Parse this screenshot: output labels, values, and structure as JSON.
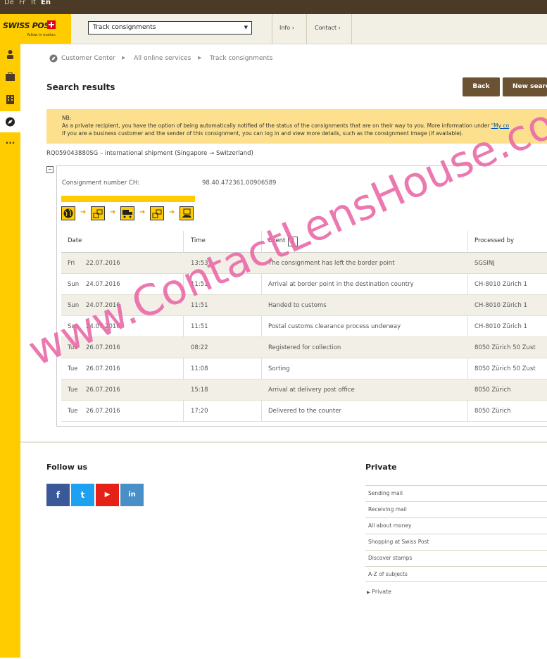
{
  "languages": [
    "De",
    "Fr",
    "It",
    "En"
  ],
  "active_language": "En",
  "logo": {
    "text": "SWISS POST",
    "tagline": "Yellow in motion."
  },
  "header": {
    "service_select": "Track consignments",
    "info": "Info",
    "contact": "Contact"
  },
  "sidebar_icons": [
    "person-icon",
    "briefcase-icon",
    "building-icon",
    "compass-icon",
    "more-icon"
  ],
  "breadcrumb": [
    "Customer Center",
    "All online services",
    "Track consignments"
  ],
  "page": {
    "title": "Search results",
    "back_button": "Back",
    "new_search_button": "New search"
  },
  "notice": {
    "line1": "NB:",
    "line2": "As a private recipient, you have the option of being automatically notified of the status of the consignments that are on their way to you. More information under",
    "link": "\"My co",
    "line3": "If you are a business customer and the sender of this consignment, you can log in and view more details, such as the consignment image (if available)."
  },
  "shipment": {
    "title": "RQ059043880SG – international shipment (Singapore → Switzerland)",
    "toggle": "–",
    "consignment_label": "Consignment number CH:",
    "consignment_value": "98.40.472361.00906589"
  },
  "table": {
    "headers": [
      "Date",
      "Time",
      "Event",
      "Processed by"
    ],
    "rows": [
      {
        "day": "Fri",
        "date": "22.07.2016",
        "time": "13:53",
        "event": "The consignment has left the border point",
        "by": "SGSINJ"
      },
      {
        "day": "Sun",
        "date": "24.07.2016",
        "time": "11:51",
        "event": "Arrival at border point in the destination country",
        "by": "CH-8010 Zürich 1"
      },
      {
        "day": "Sun",
        "date": "24.07.2016",
        "time": "11:51",
        "event": "Handed to customs",
        "by": "CH-8010 Zürich 1"
      },
      {
        "day": "Sun",
        "date": "24.07.2016",
        "time": "11:51",
        "event": "Postal customs clearance process underway",
        "by": "CH-8010 Zürich 1"
      },
      {
        "day": "Tue",
        "date": "26.07.2016",
        "time": "08:22",
        "event": "Registered for collection",
        "by": "8050 Zürich 50 Zust"
      },
      {
        "day": "Tue",
        "date": "26.07.2016",
        "time": "11:08",
        "event": "Sorting",
        "by": "8050 Zürich 50 Zust"
      },
      {
        "day": "Tue",
        "date": "26.07.2016",
        "time": "15:18",
        "event": "Arrival at delivery post office",
        "by": "8050 Zürich"
      },
      {
        "day": "Tue",
        "date": "26.07.2016",
        "time": "17:20",
        "event": "Delivered to the counter",
        "by": "8050 Zürich"
      }
    ]
  },
  "footer": {
    "follow_us": "Follow us",
    "social": [
      {
        "icon": "facebook-icon",
        "glyph": "f",
        "color": "#3b5998"
      },
      {
        "icon": "twitter-icon",
        "glyph": "t",
        "color": "#1da1f2"
      },
      {
        "icon": "youtube-icon",
        "glyph": "▶",
        "color": "#e62117"
      },
      {
        "icon": "linkedin-icon",
        "glyph": "in",
        "color": "#4a90c8"
      }
    ],
    "private_title": "Private",
    "private_links": [
      "Sending mail",
      "Receiving mail",
      "All about money",
      "Shopping at Swiss Post",
      "Discover stamps",
      "A-Z of subjects"
    ],
    "private_more": "Private"
  },
  "watermark": "www.ContactLensHouse.com",
  "colors": {
    "brand_yellow": "#ffcc00",
    "button_brown": "#6b5232",
    "notice_bg": "#fde08d",
    "watermark_pink": "#ea6aa8"
  }
}
